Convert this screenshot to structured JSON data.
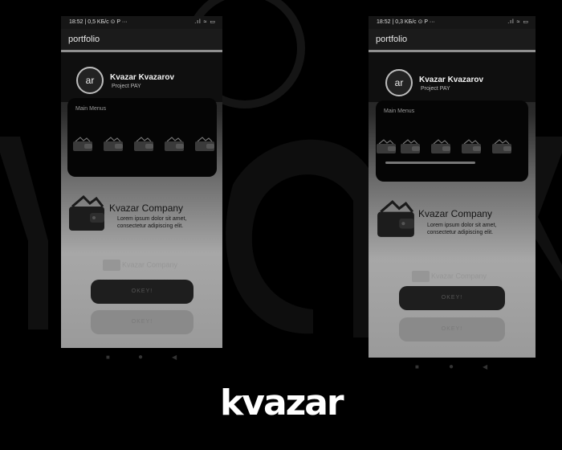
{
  "brand": {
    "logo_text": "kvazar"
  },
  "phones": [
    {
      "status": {
        "time": "18:52",
        "network": "0,5 KБ/с",
        "icons": "⊙ P ···",
        "right_icons": ".ıl ≈ ▭"
      },
      "appbar_title": "portfolio",
      "profile": {
        "avatar_text": "ar",
        "name": "Kvazar Kvazarov",
        "subtitle": "Project PAY"
      },
      "menu_title": "Main Menus",
      "company": {
        "name": "Kvazar Company",
        "desc": "Lorem ipsum dolor sit amet, consectetur adipiscing elit."
      },
      "ghost_label": "Kvazar Company",
      "buttons": [
        "OKEY!",
        "OKEY!"
      ]
    },
    {
      "status": {
        "time": "18:52",
        "network": "0,3 KБ/с",
        "icons": "⊙ P ···",
        "right_icons": ".ıl ≈ ▭"
      },
      "appbar_title": "portfolio",
      "profile": {
        "avatar_text": "ar",
        "name": "Kvazar Kvazarov",
        "subtitle": "Project PAY"
      },
      "menu_title": "Main Menus",
      "company": {
        "name": "Kvazar Company",
        "desc": "Lorem ipsum dolor sit amet, consectetur adipiscing elit."
      },
      "ghost_label": "Kvazar Company",
      "buttons": [
        "OKEY!",
        "OKEY!"
      ]
    }
  ],
  "nav_buttons": {
    "recent": "■",
    "home": "●",
    "back": "◀"
  },
  "colors": {
    "background": "#000000",
    "card": "#050505",
    "accent_text": "#141414"
  },
  "icons": [
    "wallet-icon",
    "avatar-logo",
    "signal-icon",
    "wifi-icon",
    "battery-icon"
  ]
}
